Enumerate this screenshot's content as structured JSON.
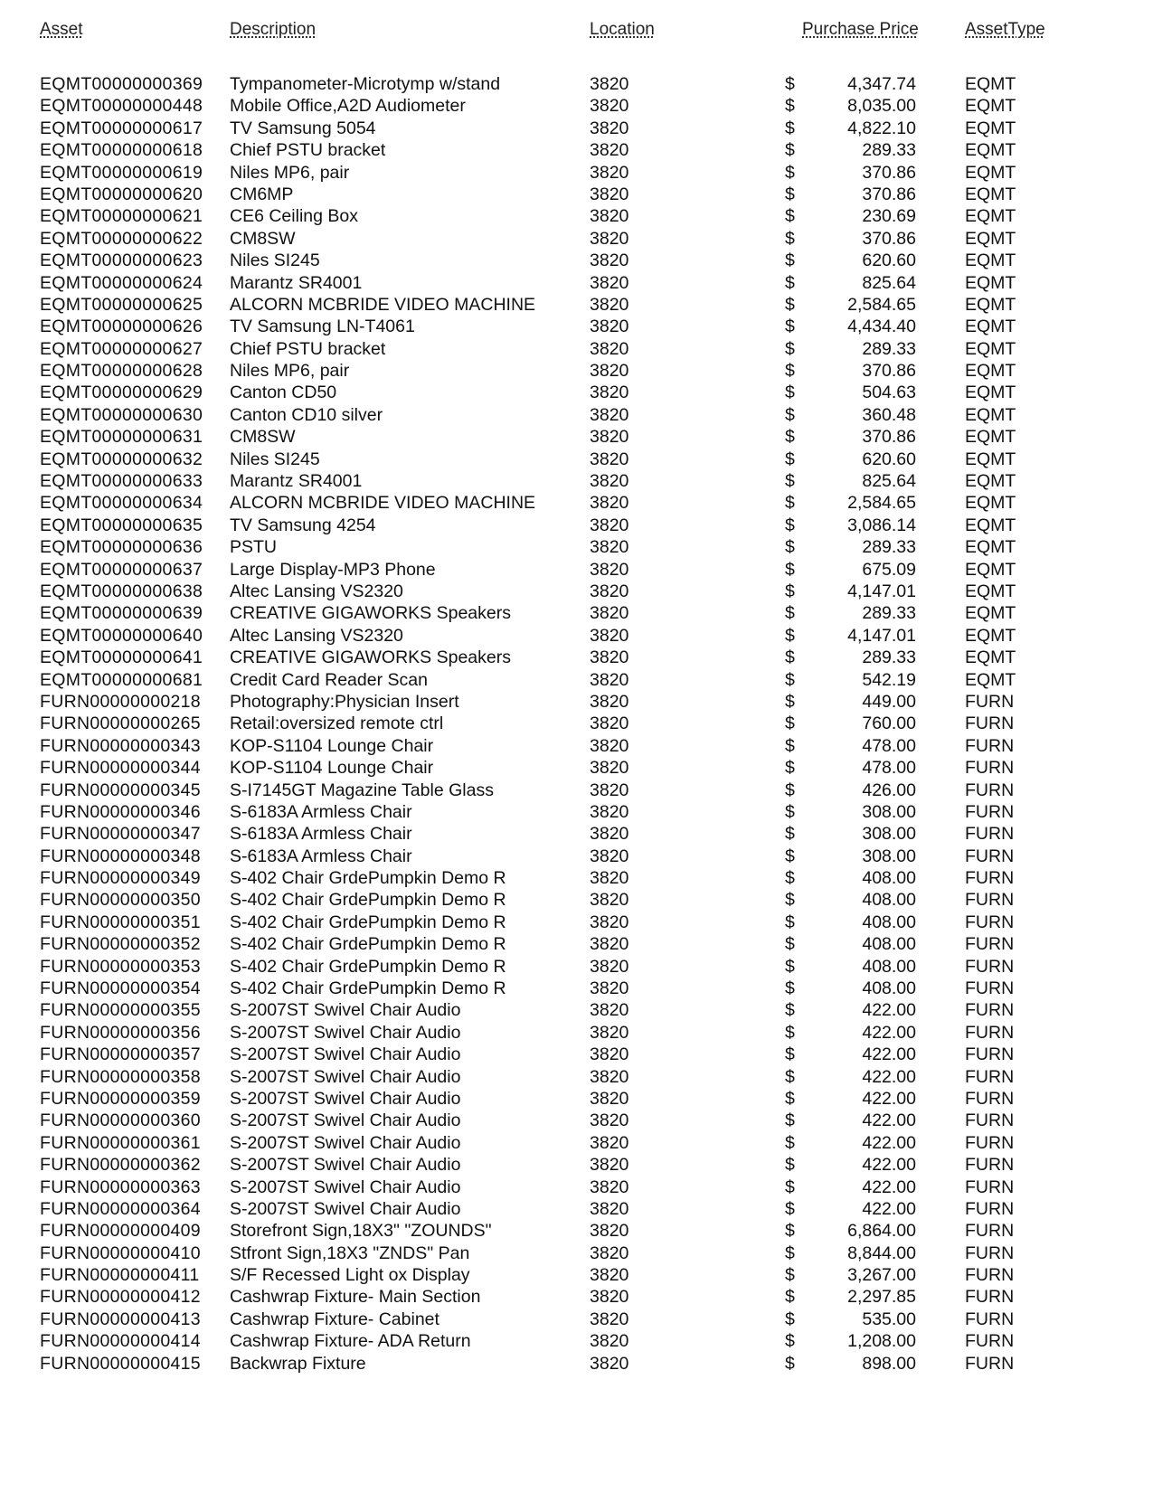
{
  "headers": {
    "asset": "Asset",
    "description": "Description",
    "location": "Location",
    "price": "Purchase Price",
    "type": "AssetType"
  },
  "currency_symbol": "$",
  "rows": [
    [
      "EQMT00000000369",
      "Tympanometer-Microtymp w/stand",
      "3820",
      "4,347.74",
      "EQMT"
    ],
    [
      "EQMT00000000448",
      "Mobile Office,A2D Audiometer",
      "3820",
      "8,035.00",
      "EQMT"
    ],
    [
      "EQMT00000000617",
      "TV Samsung 5054",
      "3820",
      "4,822.10",
      "EQMT"
    ],
    [
      "EQMT00000000618",
      "Chief PSTU bracket",
      "3820",
      "289.33",
      "EQMT"
    ],
    [
      "EQMT00000000619",
      "Niles MP6, pair",
      "3820",
      "370.86",
      "EQMT"
    ],
    [
      "EQMT00000000620",
      "CM6MP",
      "3820",
      "370.86",
      "EQMT"
    ],
    [
      "EQMT00000000621",
      "CE6 Ceiling Box",
      "3820",
      "230.69",
      "EQMT"
    ],
    [
      "EQMT00000000622",
      "CM8SW",
      "3820",
      "370.86",
      "EQMT"
    ],
    [
      "EQMT00000000623",
      "Niles SI245",
      "3820",
      "620.60",
      "EQMT"
    ],
    [
      "EQMT00000000624",
      "Marantz SR4001",
      "3820",
      "825.64",
      "EQMT"
    ],
    [
      "EQMT00000000625",
      "ALCORN MCBRIDE VIDEO MACHINE",
      "3820",
      "2,584.65",
      "EQMT"
    ],
    [
      "EQMT00000000626",
      "TV Samsung LN-T4061",
      "3820",
      "4,434.40",
      "EQMT"
    ],
    [
      "EQMT00000000627",
      "Chief PSTU bracket",
      "3820",
      "289.33",
      "EQMT"
    ],
    [
      "EQMT00000000628",
      "Niles MP6, pair",
      "3820",
      "370.86",
      "EQMT"
    ],
    [
      "EQMT00000000629",
      "Canton CD50",
      "3820",
      "504.63",
      "EQMT"
    ],
    [
      "EQMT00000000630",
      "Canton CD10 silver",
      "3820",
      "360.48",
      "EQMT"
    ],
    [
      "EQMT00000000631",
      "CM8SW",
      "3820",
      "370.86",
      "EQMT"
    ],
    [
      "EQMT00000000632",
      "Niles SI245",
      "3820",
      "620.60",
      "EQMT"
    ],
    [
      "EQMT00000000633",
      "Marantz SR4001",
      "3820",
      "825.64",
      "EQMT"
    ],
    [
      "EQMT00000000634",
      "ALCORN MCBRIDE VIDEO MACHINE",
      "3820",
      "2,584.65",
      "EQMT"
    ],
    [
      "EQMT00000000635",
      "TV Samsung 4254",
      "3820",
      "3,086.14",
      "EQMT"
    ],
    [
      "EQMT00000000636",
      "PSTU",
      "3820",
      "289.33",
      "EQMT"
    ],
    [
      "EQMT00000000637",
      "Large Display-MP3 Phone",
      "3820",
      "675.09",
      "EQMT"
    ],
    [
      "EQMT00000000638",
      "Altec Lansing VS2320",
      "3820",
      "4,147.01",
      "EQMT"
    ],
    [
      "EQMT00000000639",
      "CREATIVE GIGAWORKS Speakers",
      "3820",
      "289.33",
      "EQMT"
    ],
    [
      "EQMT00000000640",
      "Altec Lansing VS2320",
      "3820",
      "4,147.01",
      "EQMT"
    ],
    [
      "EQMT00000000641",
      "CREATIVE GIGAWORKS Speakers",
      "3820",
      "289.33",
      "EQMT"
    ],
    [
      "EQMT00000000681",
      "Credit Card Reader Scan",
      "3820",
      "542.19",
      "EQMT"
    ],
    [
      "FURN00000000218",
      "Photography:Physician Insert",
      "3820",
      "449.00",
      "FURN"
    ],
    [
      "FURN00000000265",
      "Retail:oversized remote ctrl",
      "3820",
      "760.00",
      "FURN"
    ],
    [
      "FURN00000000343",
      "KOP-S1104 Lounge Chair",
      "3820",
      "478.00",
      "FURN"
    ],
    [
      "FURN00000000344",
      "KOP-S1104 Lounge Chair",
      "3820",
      "478.00",
      "FURN"
    ],
    [
      "FURN00000000345",
      "S-I7145GT Magazine Table Glass",
      "3820",
      "426.00",
      "FURN"
    ],
    [
      "FURN00000000346",
      "S-6183A Armless Chair",
      "3820",
      "308.00",
      "FURN"
    ],
    [
      "FURN00000000347",
      "S-6183A Armless Chair",
      "3820",
      "308.00",
      "FURN"
    ],
    [
      "FURN00000000348",
      "S-6183A Armless Chair",
      "3820",
      "308.00",
      "FURN"
    ],
    [
      "FURN00000000349",
      "S-402 Chair GrdePumpkin Demo R",
      "3820",
      "408.00",
      "FURN"
    ],
    [
      "FURN00000000350",
      "S-402 Chair GrdePumpkin Demo R",
      "3820",
      "408.00",
      "FURN"
    ],
    [
      "FURN00000000351",
      "S-402 Chair GrdePumpkin Demo R",
      "3820",
      "408.00",
      "FURN"
    ],
    [
      "FURN00000000352",
      "S-402 Chair GrdePumpkin Demo R",
      "3820",
      "408.00",
      "FURN"
    ],
    [
      "FURN00000000353",
      "S-402 Chair GrdePumpkin Demo R",
      "3820",
      "408.00",
      "FURN"
    ],
    [
      "FURN00000000354",
      "S-402 Chair GrdePumpkin Demo R",
      "3820",
      "408.00",
      "FURN"
    ],
    [
      "FURN00000000355",
      "S-2007ST Swivel Chair Audio",
      "3820",
      "422.00",
      "FURN"
    ],
    [
      "FURN00000000356",
      "S-2007ST Swivel Chair Audio",
      "3820",
      "422.00",
      "FURN"
    ],
    [
      "FURN00000000357",
      "S-2007ST Swivel Chair Audio",
      "3820",
      "422.00",
      "FURN"
    ],
    [
      "FURN00000000358",
      "S-2007ST Swivel Chair Audio",
      "3820",
      "422.00",
      "FURN"
    ],
    [
      "FURN00000000359",
      "S-2007ST Swivel Chair Audio",
      "3820",
      "422.00",
      "FURN"
    ],
    [
      "FURN00000000360",
      "S-2007ST Swivel Chair Audio",
      "3820",
      "422.00",
      "FURN"
    ],
    [
      "FURN00000000361",
      "S-2007ST Swivel Chair Audio",
      "3820",
      "422.00",
      "FURN"
    ],
    [
      "FURN00000000362",
      "S-2007ST Swivel Chair Audio",
      "3820",
      "422.00",
      "FURN"
    ],
    [
      "FURN00000000363",
      "S-2007ST Swivel Chair Audio",
      "3820",
      "422.00",
      "FURN"
    ],
    [
      "FURN00000000364",
      "S-2007ST Swivel Chair Audio",
      "3820",
      "422.00",
      "FURN"
    ],
    [
      "FURN00000000409",
      "Storefront Sign,18X3\" \"ZOUNDS\"",
      "3820",
      "6,864.00",
      "FURN"
    ],
    [
      "FURN00000000410",
      "Stfront Sign,18X3 \"ZNDS\" Pan",
      "3820",
      "8,844.00",
      "FURN"
    ],
    [
      "FURN00000000411",
      "S/F Recessed Light ox Display",
      "3820",
      "3,267.00",
      "FURN"
    ],
    [
      "FURN00000000412",
      "Cashwrap Fixture- Main Section",
      "3820",
      "2,297.85",
      "FURN"
    ],
    [
      "FURN00000000413",
      "Cashwrap Fixture-  Cabinet",
      "3820",
      "535.00",
      "FURN"
    ],
    [
      "FURN00000000414",
      "Cashwrap Fixture- ADA Return",
      "3820",
      "1,208.00",
      "FURN"
    ],
    [
      "FURN00000000415",
      "Backwrap Fixture",
      "3820",
      "898.00",
      "FURN"
    ]
  ]
}
